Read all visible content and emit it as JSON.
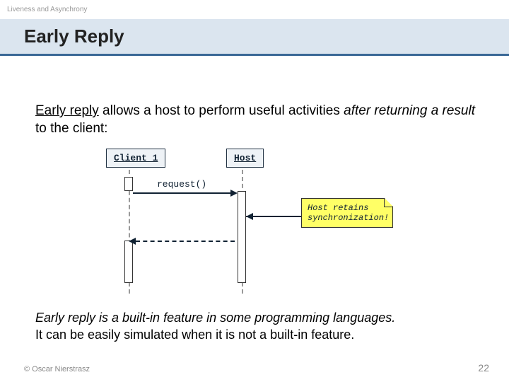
{
  "topic_label": "Liveness and Asynchrony",
  "title": "Early Reply",
  "intro": {
    "term": "Early reply",
    "middle1": " allows a host to perform useful activities ",
    "italic_phrase": "after returning a result",
    "middle2": " to the client:"
  },
  "diagram": {
    "actors": {
      "client": "Client 1",
      "host": "Host"
    },
    "message_request": "request()",
    "note_text": "Host retains synchronization!"
  },
  "outro": {
    "line1_italic": "Early reply is a built-in feature in some programming languages.",
    "line2": "It can be easily simulated when it is not a built-in feature."
  },
  "footer": {
    "copyright": "© Oscar Nierstrasz",
    "page": "22"
  }
}
